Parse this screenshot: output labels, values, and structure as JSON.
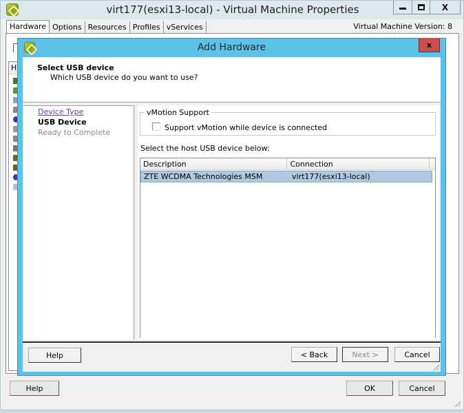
{
  "window": {
    "title": "virt177(esxi13-local) - Virtual Machine Properties",
    "controls": {
      "minimize": "minimize",
      "maximize": "maximize",
      "close": "X"
    },
    "tabs": [
      {
        "label": "Hardware",
        "active": true
      },
      {
        "label": "Options",
        "active": false
      },
      {
        "label": "Resources",
        "active": false
      },
      {
        "label": "Profiles",
        "active": false
      },
      {
        "label": "vServices",
        "active": false
      }
    ],
    "vm_version": "Virtual Machine Version: 8",
    "background_list_header": "Ha",
    "footer": {
      "help_label": "Help",
      "ok_label": "OK",
      "cancel_label": "Cancel"
    }
  },
  "dialog": {
    "title": "Add Hardware",
    "close_label": "x",
    "header": {
      "title": "Select USB device",
      "subtitle": "Which USB device do you want to use?"
    },
    "steps": [
      {
        "label": "Device Type",
        "state": "completed"
      },
      {
        "label": "USB Device",
        "state": "current"
      },
      {
        "label": "Ready to Complete",
        "state": "pending"
      }
    ],
    "vmotion": {
      "legend": "vMotion Support",
      "checkbox_label": "Support vMotion while device is connected",
      "checked": false
    },
    "select_label": "Select the host USB device below:",
    "table": {
      "columns": [
        "Description",
        "Connection"
      ],
      "rows": [
        {
          "description": "ZTE WCDMA Technologies MSM",
          "connection": "virt177(esxi13-local)",
          "selected": true
        }
      ]
    },
    "footer": {
      "help_label": "Help",
      "back_label": "< Back",
      "next_label": "Next >",
      "next_enabled": false,
      "cancel_label": "Cancel"
    }
  }
}
